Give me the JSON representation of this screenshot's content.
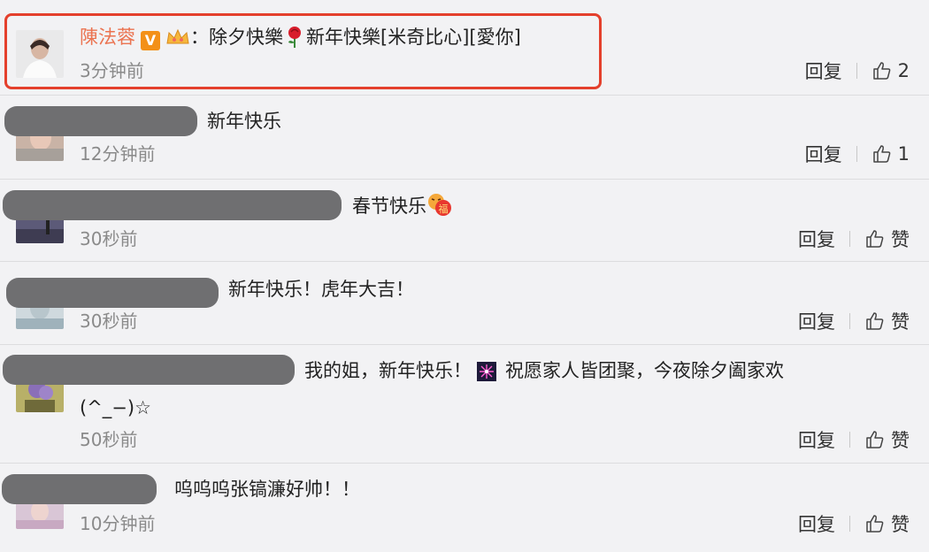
{
  "actions": {
    "reply_label": "回复",
    "like_label": "赞"
  },
  "comments": [
    {
      "user": "陳法蓉",
      "separator": "：",
      "text_a": "除夕快樂",
      "text_b": "新年快樂[米奇比心][愛你]",
      "time": "3分钟前",
      "likes": "2"
    },
    {
      "text": "新年快乐",
      "time": "12分钟前",
      "likes": "1"
    },
    {
      "text": "春节快乐",
      "time": "30秒前",
      "likes": "赞"
    },
    {
      "text": "新年快乐！虎年大吉！",
      "time": "30秒前",
      "likes": "赞"
    },
    {
      "text_a": "我的姐，新年快乐！",
      "text_b": "祝愿家人皆团聚，今夜除夕阖家欢",
      "text_c": "(^_−)☆",
      "time": "50秒前",
      "likes": "赞"
    },
    {
      "text": "呜呜呜张镐濂好帅！！",
      "time": "10分钟前",
      "likes": "赞"
    }
  ],
  "colors": {
    "username": "#eb7350",
    "highlight": "#e4402c",
    "redaction": "#6f6f71"
  }
}
